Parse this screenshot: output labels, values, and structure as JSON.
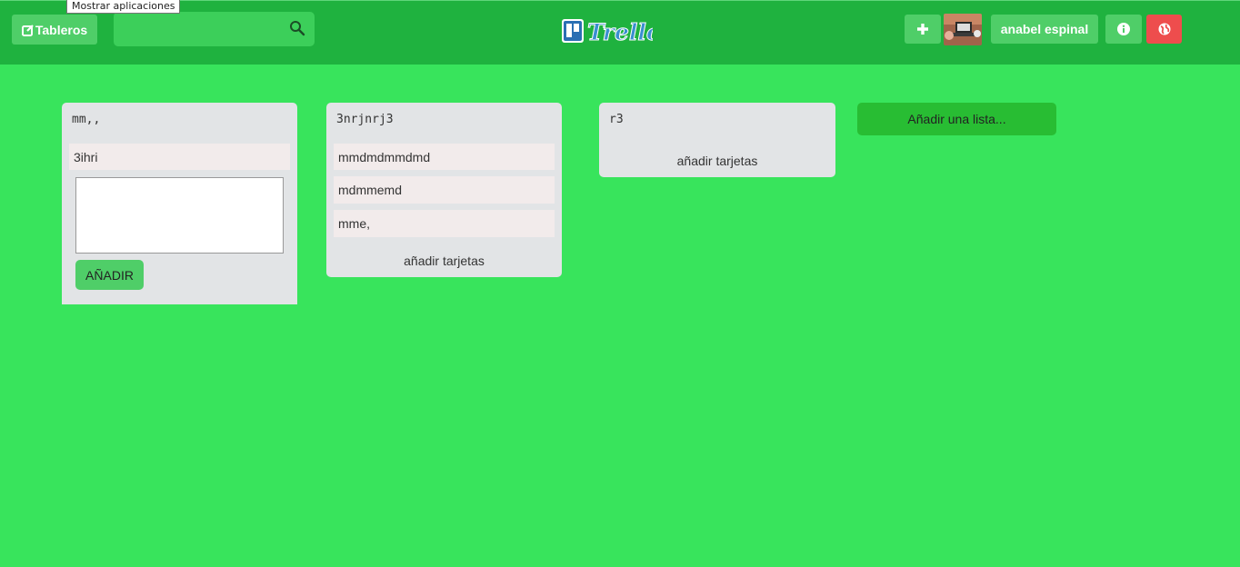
{
  "tooltip": "Mostrar aplicaciones",
  "header": {
    "boards_label": "Tableros",
    "search": {
      "value": "",
      "placeholder": ""
    },
    "logo_text": "Trello",
    "user_name": "anabel espinal"
  },
  "lists": [
    {
      "title": "mm,,",
      "cards": [
        "3ihri"
      ],
      "composer": {
        "value": "",
        "button": "AÑADIR"
      }
    },
    {
      "title": "3nrjnrj3",
      "cards": [
        "mmdmdmmdmd",
        "mdmmemd",
        "mme,"
      ],
      "add_cards": "añadir tarjetas"
    },
    {
      "title": "r3",
      "cards": [],
      "add_cards": "añadir tarjetas"
    }
  ],
  "add_list_label": "Añadir una lista...",
  "colors": {
    "background": "#38e45c",
    "header": "#1fb23f",
    "button": "#4fce68",
    "danger": "#ee4d4d",
    "list": "#e2e4e6",
    "card": "#f2ebeb"
  }
}
